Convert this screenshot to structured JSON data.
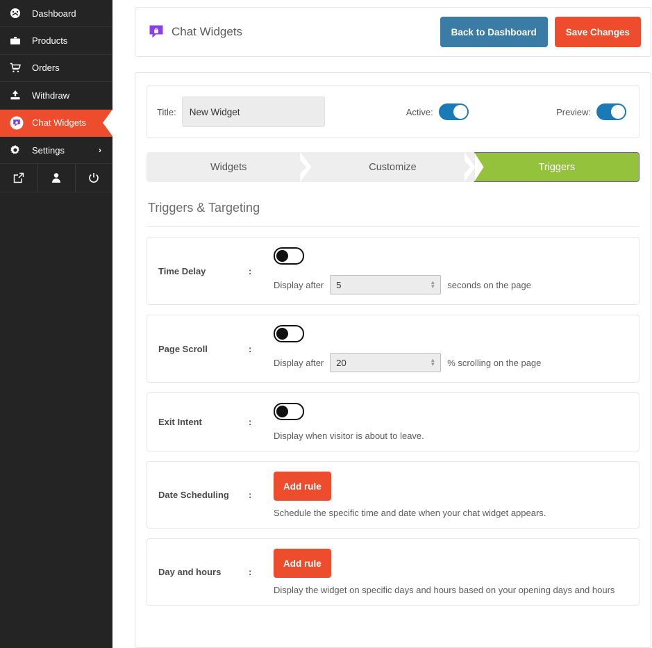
{
  "sidebar": {
    "items": [
      {
        "label": "Dashboard",
        "icon": "dashboard-icon",
        "active": false
      },
      {
        "label": "Products",
        "icon": "briefcase-icon",
        "active": false
      },
      {
        "label": "Orders",
        "icon": "cart-icon",
        "active": false
      },
      {
        "label": "Withdraw",
        "icon": "upload-icon",
        "active": false
      },
      {
        "label": "Chat Widgets",
        "icon": "chat-widget-icon",
        "active": true
      },
      {
        "label": "Settings",
        "icon": "gear-icon",
        "active": false,
        "chevron": "›"
      }
    ],
    "bottom_icons": [
      {
        "name": "external-link-icon"
      },
      {
        "name": "user-icon"
      },
      {
        "name": "power-icon"
      }
    ]
  },
  "header": {
    "title": "Chat Widgets",
    "icon": "chat-widget-icon",
    "back_button": "Back to Dashboard",
    "save_button": "Save Changes"
  },
  "title_row": {
    "label": "Title:",
    "value": "New Widget",
    "placeholder": "New Widget",
    "active_label": "Active:",
    "active_on": true,
    "preview_label": "Preview:",
    "preview_on": true
  },
  "tabs": [
    {
      "label": "Widgets",
      "active": false
    },
    {
      "label": "Customize",
      "active": false
    },
    {
      "label": "Triggers",
      "active": true
    }
  ],
  "section": {
    "heading": "Triggers & Targeting"
  },
  "triggers": [
    {
      "name": "Time Delay",
      "colon": ":",
      "type": "toggle-number",
      "toggle_on": false,
      "prefix": "Display after",
      "value": "5",
      "suffix": "seconds on the page"
    },
    {
      "name": "Page Scroll",
      "colon": ":",
      "type": "toggle-number",
      "toggle_on": false,
      "prefix": "Display after",
      "value": "20",
      "suffix": "% scrolling on the page"
    },
    {
      "name": "Exit Intent",
      "colon": ":",
      "type": "toggle-text",
      "toggle_on": false,
      "description": "Display when visitor is about to leave."
    },
    {
      "name": "Date Scheduling",
      "colon": ":",
      "type": "button-text",
      "button": "Add rule",
      "description": "Schedule the specific time and date when your chat widget appears."
    },
    {
      "name": "Day and hours",
      "colon": ":",
      "type": "button-text",
      "button": "Add rule",
      "description": "Display the widget on specific days and hours based on your opening days and hours"
    }
  ],
  "colors": {
    "sidebar_bg": "#242424",
    "accent_orange": "#ee4d2d",
    "accent_blue": "#3a7ca5",
    "toggle_blue": "#1a7ab8",
    "tab_green": "#95c23d",
    "tab_border_purple": "#7e5a8e",
    "tab_inactive": "#eeeeee"
  }
}
